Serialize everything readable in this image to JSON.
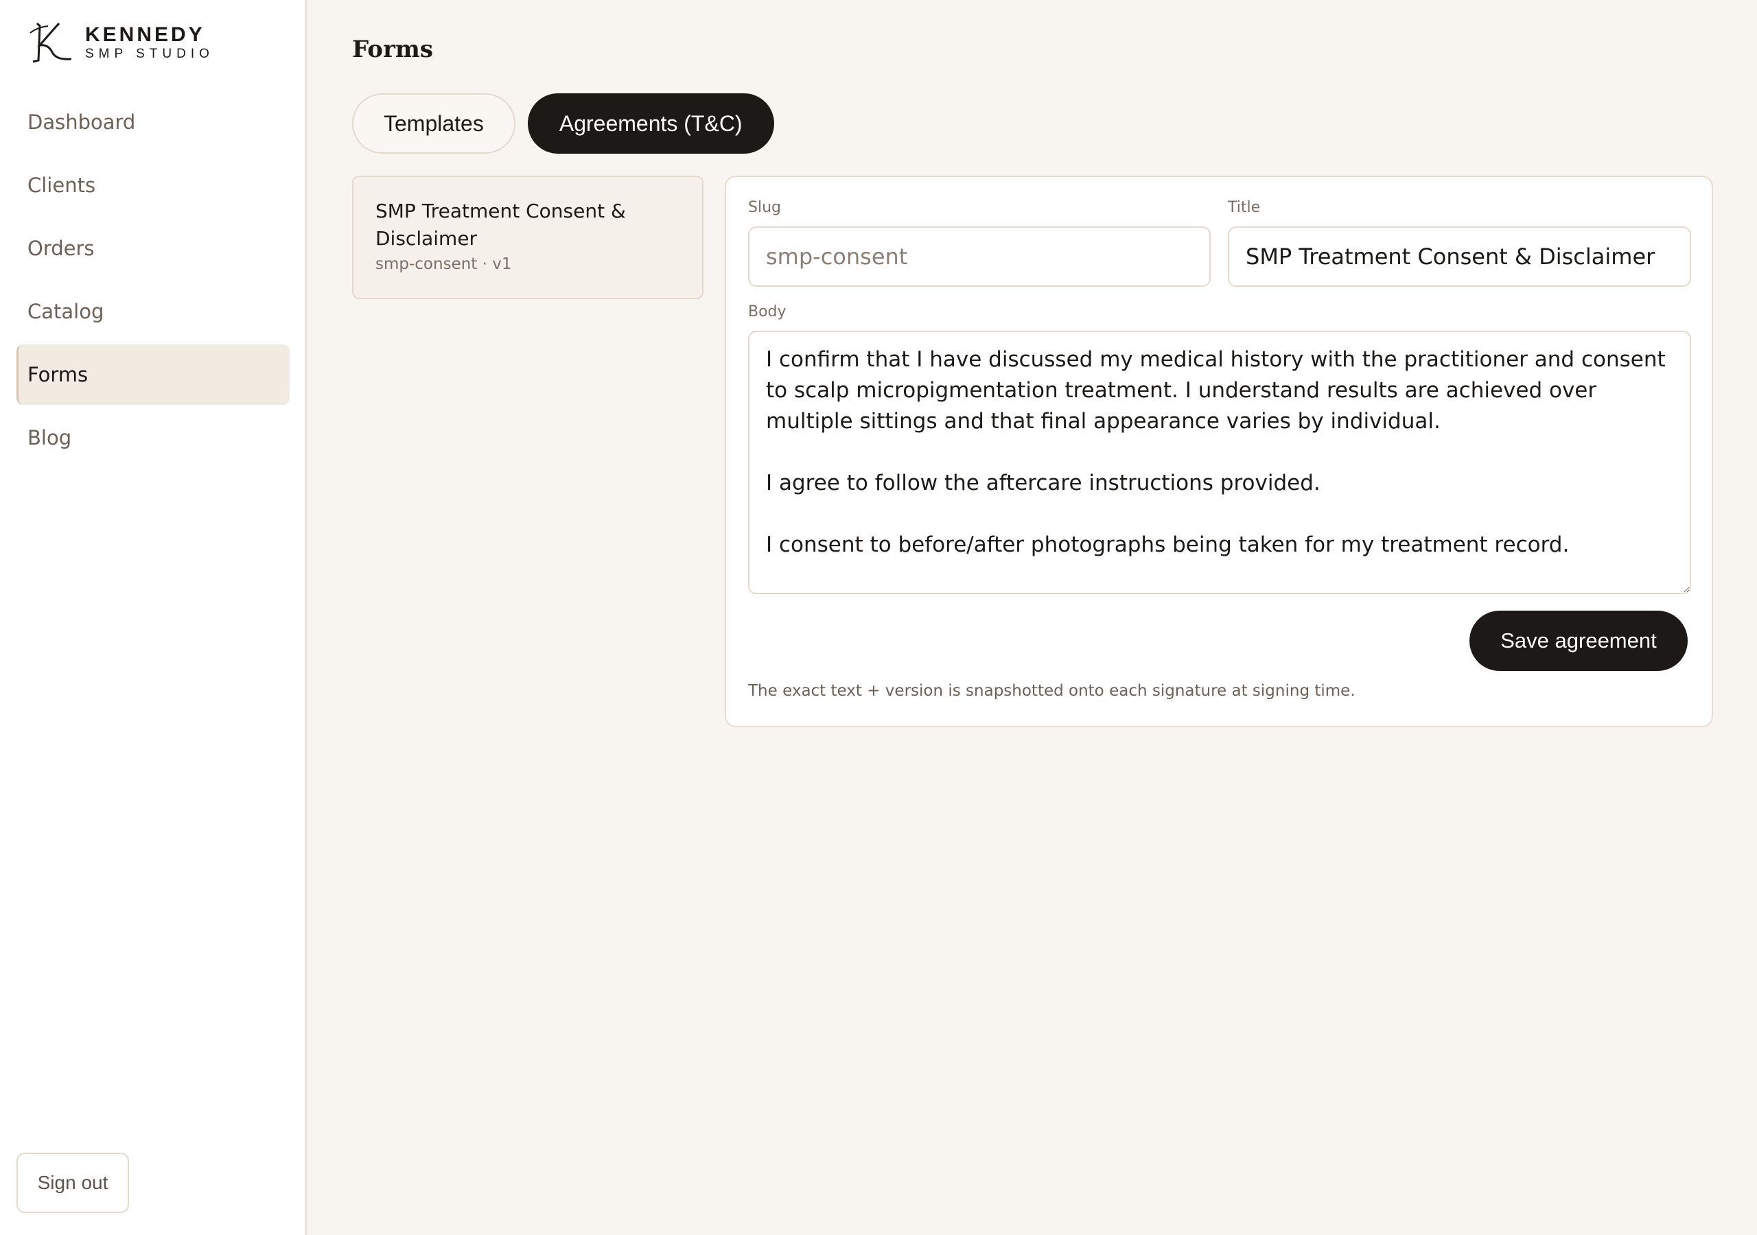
{
  "brand": {
    "name": "KENNEDY",
    "subtitle": "SMP STUDIO",
    "logo_icon": "k-monogram-logo"
  },
  "sidebar": {
    "items": [
      {
        "label": "Dashboard",
        "active": false
      },
      {
        "label": "Clients",
        "active": false
      },
      {
        "label": "Orders",
        "active": false
      },
      {
        "label": "Catalog",
        "active": false
      },
      {
        "label": "Forms",
        "active": true
      },
      {
        "label": "Blog",
        "active": false
      }
    ],
    "signout_label": "Sign out"
  },
  "main": {
    "title": "Forms",
    "tabs": [
      {
        "label": "Templates",
        "selected": false
      },
      {
        "label": "Agreements (T&C)",
        "selected": true
      }
    ],
    "agreement_list": [
      {
        "title": "SMP Treatment Consent & Disclaimer",
        "meta": "smp-consent · v1"
      }
    ],
    "editor": {
      "slug_label": "Slug",
      "slug_value": "",
      "slug_placeholder": "smp-consent",
      "title_label": "Title",
      "title_value": "SMP Treatment Consent & Disclaimer",
      "body_label": "Body",
      "body_value": "I confirm that I have discussed my medical history with the practitioner and consent to scalp micropigmentation treatment. I understand results are achieved over multiple sittings and that final appearance varies by individual.\n\nI agree to follow the aftercare instructions provided.\n\nI consent to before/after photographs being taken for my treatment record.",
      "save_label": "Save agreement",
      "note": "The exact text + version is snapshotted onto each signature at signing time."
    }
  },
  "colors": {
    "accent": "#1c1917",
    "background": "#f8f5f0",
    "active_nav": "#f2ebe1",
    "border": "#e3d9cc"
  }
}
